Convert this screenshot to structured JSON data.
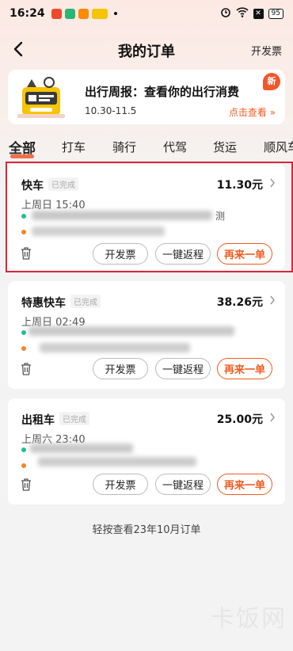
{
  "status_bar": {
    "time": "16:24",
    "battery": "95"
  },
  "header": {
    "title": "我的订单",
    "invoice_label": "开发票"
  },
  "banner": {
    "title": "出行周报：查看你的出行消费",
    "date_range": "10.30-11.5",
    "cta": "点击查看 »",
    "badge": "新"
  },
  "tabs": [
    "全部",
    "打车",
    "骑行",
    "代驾",
    "货运",
    "顺风车"
  ],
  "orders": [
    {
      "service": "快车",
      "status": "已完成",
      "price": "11.30元",
      "time": "上周日 15:40",
      "route_tail": "测",
      "buttons": {
        "invoice": "开发票",
        "return": "一键返程",
        "again": "再来一单"
      }
    },
    {
      "service": "特惠快车",
      "status": "已完成",
      "price": "38.26元",
      "time": "上周日 02:49",
      "route_tail": "",
      "buttons": {
        "invoice": "开发票",
        "return": "一键返程",
        "again": "再来一单"
      }
    },
    {
      "service": "出租车",
      "status": "已完成",
      "price": "25.00元",
      "time": "上周六 23:40",
      "route_tail": "",
      "buttons": {
        "invoice": "开发票",
        "return": "一键返程",
        "again": "再来一单"
      }
    }
  ],
  "footer": {
    "history": "轻按查看23年10月订单"
  },
  "watermark": "卡饭网",
  "colors": {
    "accent": "#f25a1f",
    "badge": "#f2562b",
    "highlight": "#d8263c",
    "start_dot": "#1fbf8f",
    "end_dot": "#f5832b"
  }
}
